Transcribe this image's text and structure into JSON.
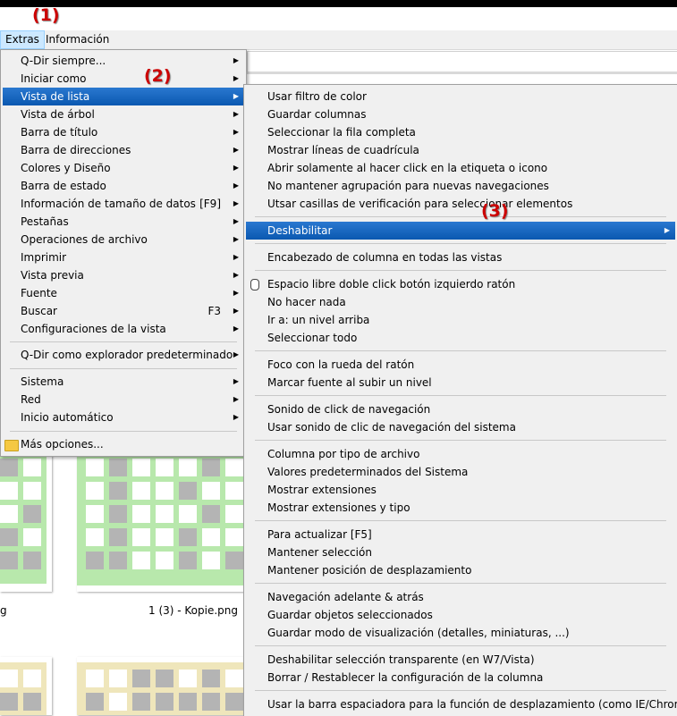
{
  "menubar": {
    "extras": "Extras",
    "info": "Información"
  },
  "annotations": {
    "a1": "(1)",
    "a2": "(2)",
    "a3": "(3)"
  },
  "main_menu": {
    "items": [
      {
        "label": "Q-Dir siempre...",
        "arrow": true
      },
      {
        "label": "Iniciar como",
        "arrow": true
      },
      {
        "label": "Vista de lista",
        "arrow": true,
        "highlighted": true
      },
      {
        "label": "Vista de árbol",
        "arrow": true
      },
      {
        "label": "Barra de título",
        "arrow": true
      },
      {
        "label": "Barra de direcciones",
        "arrow": true
      },
      {
        "label": "Colores y Diseño",
        "arrow": true
      },
      {
        "label": "Barra de estado",
        "arrow": true
      },
      {
        "label": "Información de tamaño de datos",
        "shortcut": "[F9]",
        "arrow": true
      },
      {
        "label": "Pestañas",
        "arrow": true
      },
      {
        "label": "Operaciones de archivo",
        "arrow": true
      },
      {
        "label": "Imprimir",
        "arrow": true
      },
      {
        "label": "Vista previa",
        "arrow": true
      },
      {
        "label": "Fuente",
        "arrow": true
      },
      {
        "label": "Buscar",
        "shortcut": "F3",
        "arrow": true
      },
      {
        "label": "Configuraciones de la vista",
        "arrow": true
      },
      {
        "label": "Q-Dir como explorador predeterminado",
        "arrow": true
      },
      {
        "label": "Sistema",
        "arrow": true
      },
      {
        "label": "Red",
        "arrow": true
      },
      {
        "label": "Inicio automático",
        "arrow": true
      },
      {
        "label": "Más opciones...",
        "arrow": false,
        "icon": "folder-icon"
      }
    ]
  },
  "submenu": {
    "items": [
      {
        "label": "Usar filtro de color"
      },
      {
        "label": "Guardar columnas"
      },
      {
        "label": "Seleccionar la fila completa"
      },
      {
        "label": "Mostrar líneas de cuadrícula"
      },
      {
        "label": "Abrir solamente al hacer click en la etiqueta o icono"
      },
      {
        "label": "No mantener agrupación para nuevas navegaciones"
      },
      {
        "label": "Utsar casillas de verificación para seleccionar elementos"
      },
      {
        "label": "Deshabilitar",
        "highlighted": true,
        "arrow": true
      },
      {
        "label": "Encabezado de columna en todas las vistas"
      },
      {
        "label": "Espacio libre doble click botón izquierdo ratón",
        "icon": "mouse-icon"
      },
      {
        "label": "No hacer nada"
      },
      {
        "label": "Ir a: un nivel arriba"
      },
      {
        "label": "Seleccionar todo"
      },
      {
        "label": "Foco con la rueda del ratón"
      },
      {
        "label": "Marcar fuente al subir un nivel"
      },
      {
        "label": "Sonido de click de navegación"
      },
      {
        "label": "Usar sonido de clic de navegación del sistema"
      },
      {
        "label": "Columna por tipo de archivo"
      },
      {
        "label": "Valores predeterminados del Sistema"
      },
      {
        "label": "Mostrar extensiones"
      },
      {
        "label": "Mostrar extensiones y tipo"
      },
      {
        "label": "Para actualizar [F5]"
      },
      {
        "label": "Mantener selección"
      },
      {
        "label": "Mantener posición de desplazamiento"
      },
      {
        "label": "Navegación adelante & atrás"
      },
      {
        "label": "Guardar objetos seleccionados"
      },
      {
        "label": "Guardar modo de visualización (detalles, miniaturas, ...)"
      },
      {
        "label": "Deshabilitar selección transparente (en W7/Vista)"
      },
      {
        "label": "Borrar / Restablecer la configuración de la columna"
      },
      {
        "label": "Usar la barra espaciadora para la función de desplazamiento (como IE/Chrome)"
      }
    ]
  },
  "files": {
    "label_left": "g",
    "label_right": "1 (3) - Kopie.png"
  },
  "colors": {
    "highlight": "#0a58b0",
    "annotation": "#cc0000",
    "thumb_border_green": "#b4e4a8",
    "thumb_cell_gray": "#b4b4b4",
    "thumb_border_tan": "#ece4b8"
  }
}
